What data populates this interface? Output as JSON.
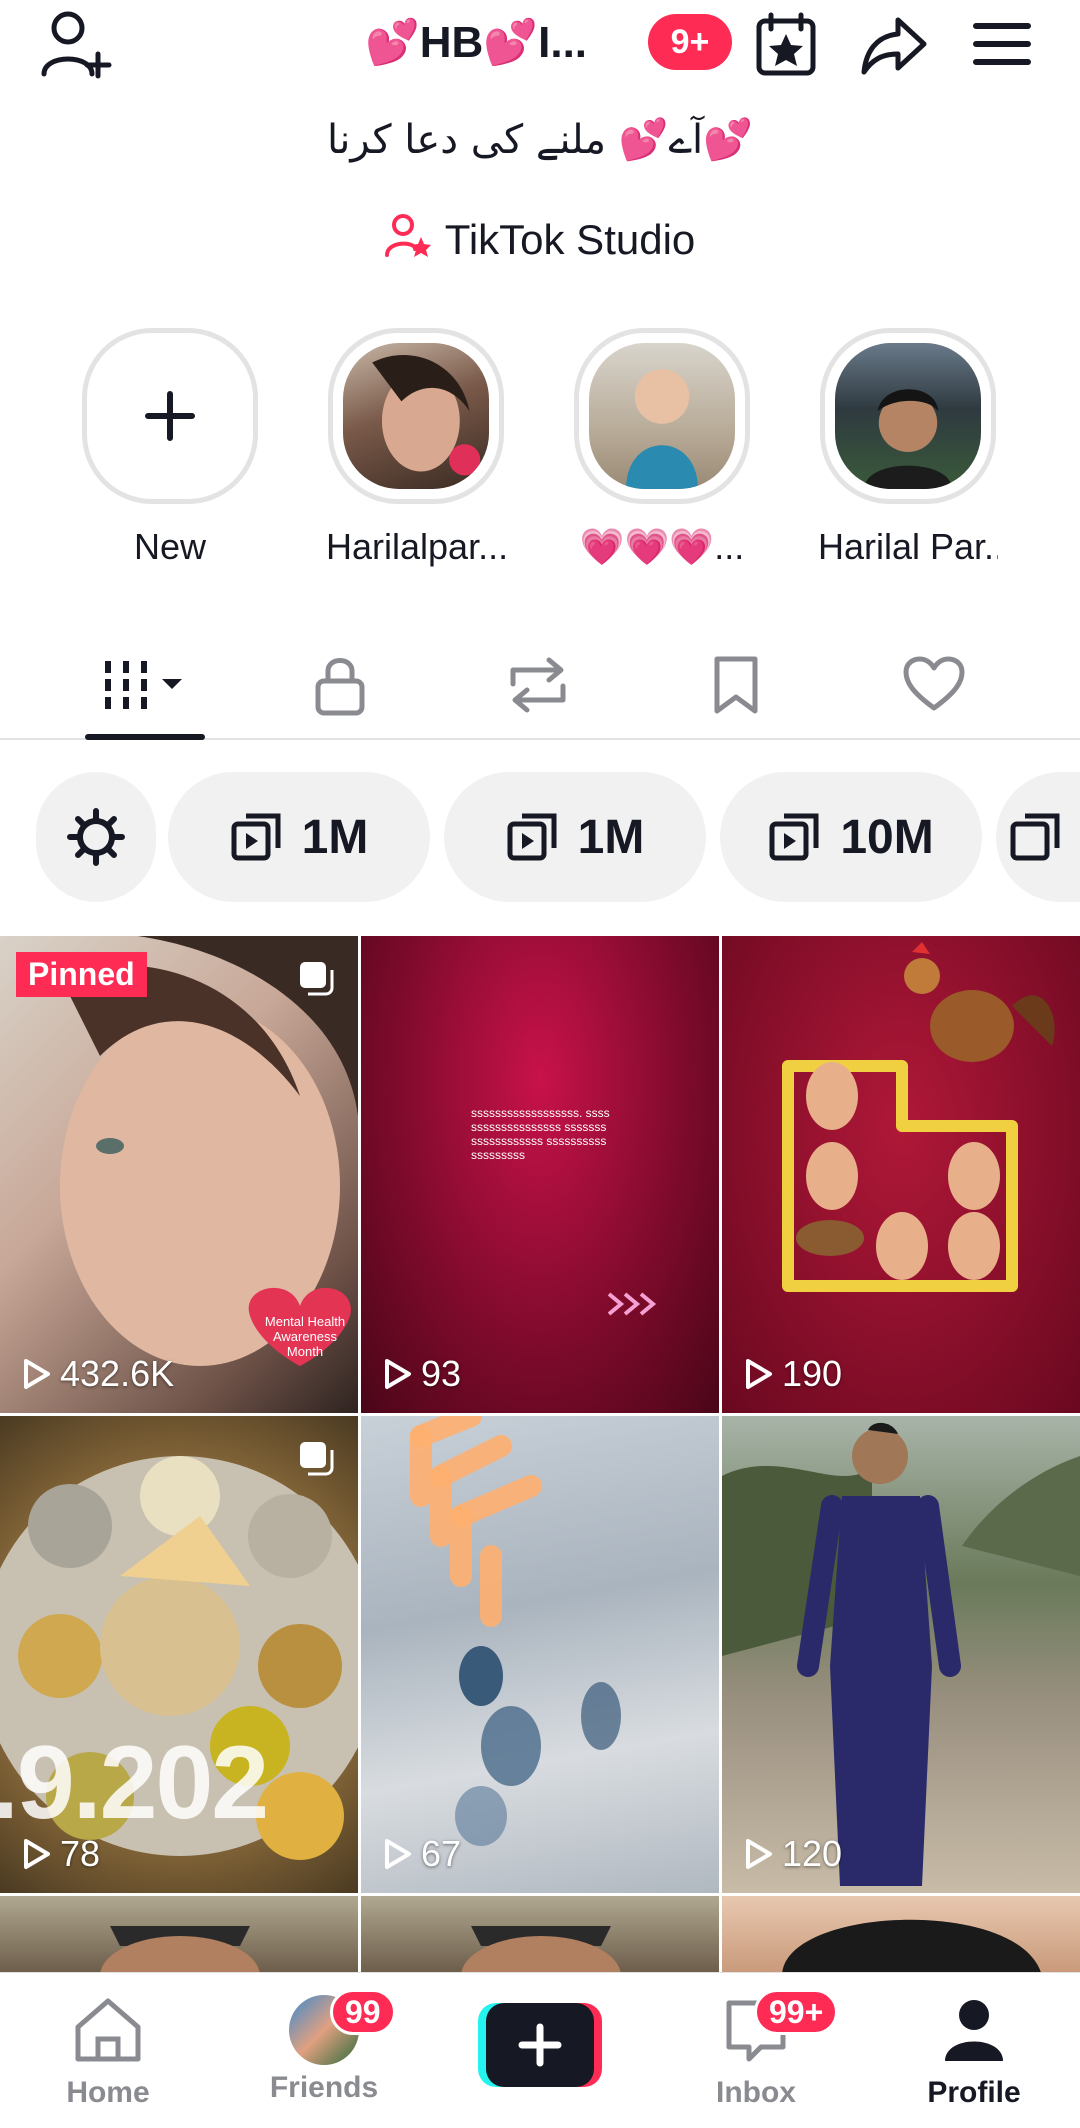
{
  "header": {
    "username": "💕HB💕I...",
    "notification_badge": "9+"
  },
  "bio": "آے💕 ملنے کی دعا کرنا💕",
  "studio_label": "TikTok Studio",
  "stories": [
    {
      "label": "New"
    },
    {
      "label": "Harilalpar..."
    },
    {
      "label": "💗💗💗..."
    },
    {
      "label": "Harilal Par..."
    }
  ],
  "chips": [
    {
      "label": "1M"
    },
    {
      "label": "1M"
    },
    {
      "label": "10M"
    }
  ],
  "videos": [
    {
      "views": "432.6K",
      "pinned_label": "Pinned",
      "overlay_text": "Mental Health Awareness Month"
    },
    {
      "views": "93",
      "overlay_text": "ssssssssssssssssss. sssssssssssssssssss sssssssssssssssssss sssssssssssssssssss"
    },
    {
      "views": "190"
    },
    {
      "views": "78",
      "overlay_text": ".9.202"
    },
    {
      "views": "67"
    },
    {
      "views": "120"
    }
  ],
  "bottom_nav": {
    "home": "Home",
    "friends": "Friends",
    "friends_badge": "99",
    "inbox": "Inbox",
    "inbox_badge": "99+",
    "profile": "Profile"
  },
  "colors": {
    "accent": "#fe2c55",
    "cyan": "#25f4ee",
    "text": "#161823",
    "muted": "#8a8b91"
  }
}
